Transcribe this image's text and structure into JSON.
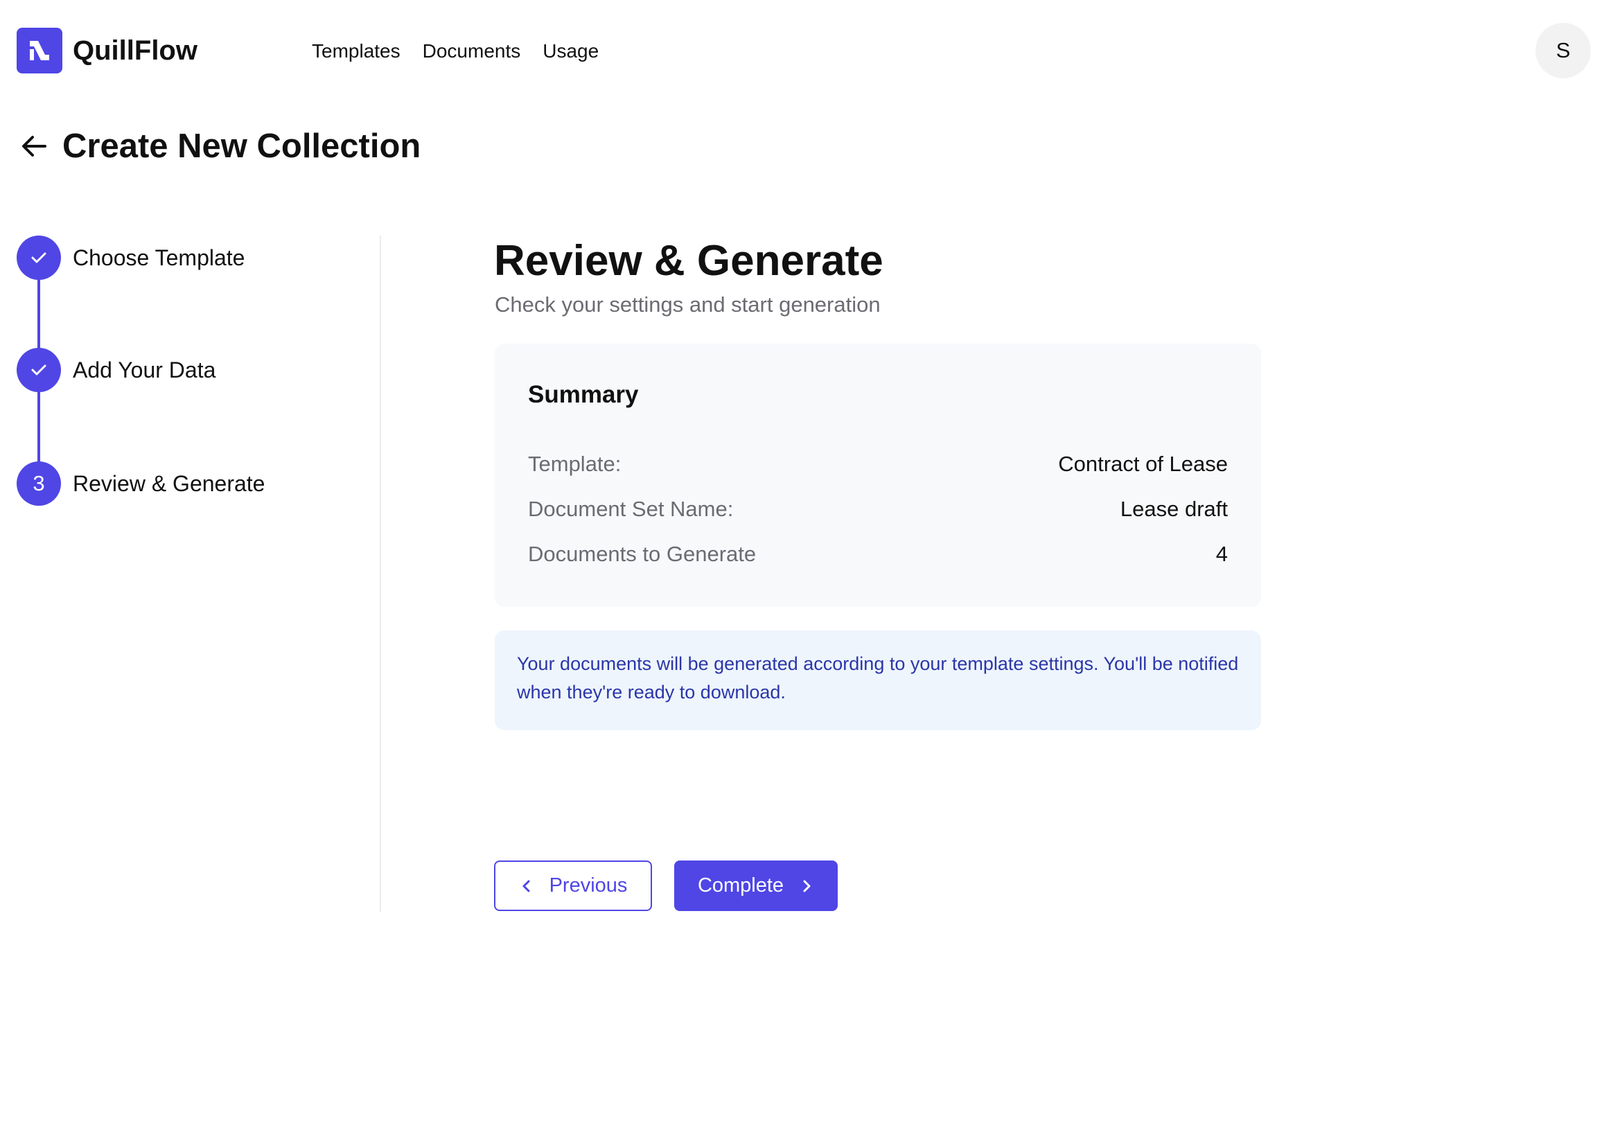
{
  "header": {
    "brand": "QuillFlow",
    "nav": [
      "Templates",
      "Documents",
      "Usage"
    ],
    "avatar_initial": "S"
  },
  "page": {
    "title": "Create New Collection"
  },
  "stepper": {
    "steps": [
      {
        "label": "Choose Template",
        "status": "complete",
        "marker": ""
      },
      {
        "label": "Add Your Data",
        "status": "complete",
        "marker": ""
      },
      {
        "label": "Review & Generate",
        "status": "current",
        "marker": "3"
      }
    ]
  },
  "main": {
    "title": "Review & Generate",
    "subtitle": "Check your settings and start generation",
    "summary": {
      "title": "Summary",
      "rows": [
        {
          "key": "Template:",
          "value": "Contract of Lease"
        },
        {
          "key": "Document Set Name:",
          "value": "Lease draft"
        },
        {
          "key": "Documents to Generate",
          "value": "4"
        }
      ]
    },
    "info": "Your documents will be generated according to your template settings. You'll be notified when they're ready to download."
  },
  "actions": {
    "previous_label": "Previous",
    "complete_label": "Complete"
  },
  "colors": {
    "accent": "#4f46e5",
    "info_bg": "#eef5fd",
    "info_text": "#2b36a8",
    "card_bg": "#f8f9fb"
  },
  "icons": {
    "logo": "quillflow-logo-icon",
    "back": "arrow-left-icon",
    "check": "check-icon",
    "prev": "chevron-left-icon",
    "next": "chevron-right-icon"
  }
}
